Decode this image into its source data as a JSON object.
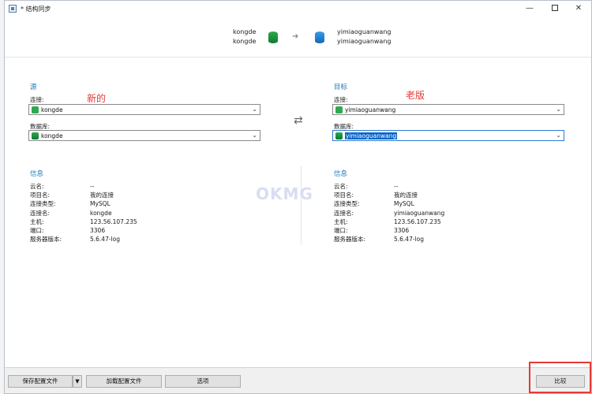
{
  "window": {
    "title": "* 结构同步"
  },
  "header": {
    "source_conn": "kongde",
    "source_db": "kongde",
    "target_conn": "yimiaoguanwang",
    "target_db": "yimiaoguanwang"
  },
  "source": {
    "title": "源",
    "annotation": "新的",
    "connection_label": "连接:",
    "connection_value": "kongde",
    "database_label": "数据库:",
    "database_value": "kongde",
    "info_title": "信息",
    "info": [
      {
        "key": "云名:",
        "value": "--"
      },
      {
        "key": "项目名:",
        "value": "我的连接"
      },
      {
        "key": "连接类型:",
        "value": "MySQL"
      },
      {
        "key": "连接名:",
        "value": "kongde"
      },
      {
        "key": "主机:",
        "value": "123.56.107.235"
      },
      {
        "key": "端口:",
        "value": "3306"
      },
      {
        "key": "服务器版本:",
        "value": "5.6.47-log"
      }
    ]
  },
  "target": {
    "title": "目标",
    "annotation": "老版",
    "connection_label": "连接:",
    "connection_value": "yimiaoguanwang",
    "database_label": "数据库:",
    "database_value": "yimiaoguanwang",
    "info_title": "信息",
    "info": [
      {
        "key": "云名:",
        "value": "--"
      },
      {
        "key": "项目名:",
        "value": "我的连接"
      },
      {
        "key": "连接类型:",
        "value": "MySQL"
      },
      {
        "key": "连接名:",
        "value": "yimiaoguanwang"
      },
      {
        "key": "主机:",
        "value": "123.56.107.235"
      },
      {
        "key": "端口:",
        "value": "3306"
      },
      {
        "key": "服务器版本:",
        "value": "5.6.47-log"
      }
    ]
  },
  "watermark": "OKMG",
  "footer": {
    "save_config": "保存配置文件",
    "load_config": "加载配置文件",
    "options": "选项",
    "compare": "比较"
  },
  "colors": {
    "accent": "#1f7ab8",
    "annotation": "#e53935",
    "selection": "#0a64c8"
  }
}
